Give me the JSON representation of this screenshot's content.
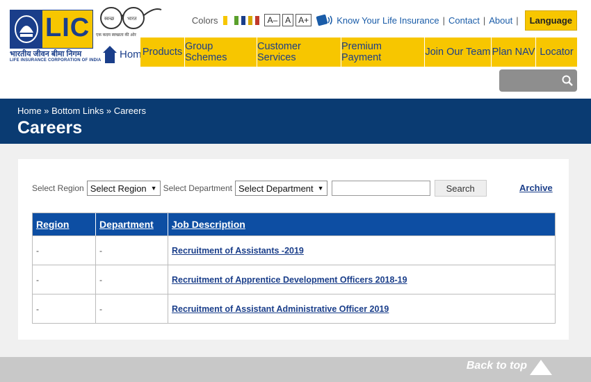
{
  "logo": {
    "text": "LIC",
    "hindi": "भारतीय जीवन बीमा निगम",
    "english": "LIFE INSURANCE CORPORATION OF INDIA"
  },
  "swachh": {
    "left": "स्वच्छ",
    "right": "भारत",
    "tagline": "एक कदम स्वच्छता की ओर"
  },
  "topbar": {
    "colors_label": "Colors",
    "swatches": [
      "#f7c600",
      "#5aa02c",
      "#1a3e8a",
      "#d4a800",
      "#c0392b"
    ],
    "font_small": "A–",
    "font_normal": "A",
    "font_large": "A+",
    "links": [
      "Know Your Life Insurance",
      "Contact",
      "About"
    ],
    "language": "Language"
  },
  "nav": {
    "home": "Home",
    "items": [
      "Products",
      "Group Schemes",
      "Customer Services",
      "Premium Payment",
      "Join Our Team",
      "Plan NAV",
      "Locator"
    ]
  },
  "banner": {
    "breadcrumb": "Home » Bottom Links » Careers",
    "title": "Careers"
  },
  "filters": {
    "region_label": "Select Region",
    "region_value": "Select Region",
    "department_label": "Select Department",
    "department_value": "Select Department",
    "search_button": "Search",
    "archive": "Archive"
  },
  "table": {
    "headers": [
      "Region",
      "Department",
      "Job Description"
    ],
    "rows": [
      [
        "-",
        "-",
        "Recruitment of Assistants -2019"
      ],
      [
        "-",
        "-",
        "Recruitment of Apprentice Development Officers 2018-19"
      ],
      [
        "-",
        "-",
        "Recruitment of Assistant Administrative Officer 2019"
      ]
    ]
  },
  "footer": {
    "back_to_top": "Back to top"
  }
}
